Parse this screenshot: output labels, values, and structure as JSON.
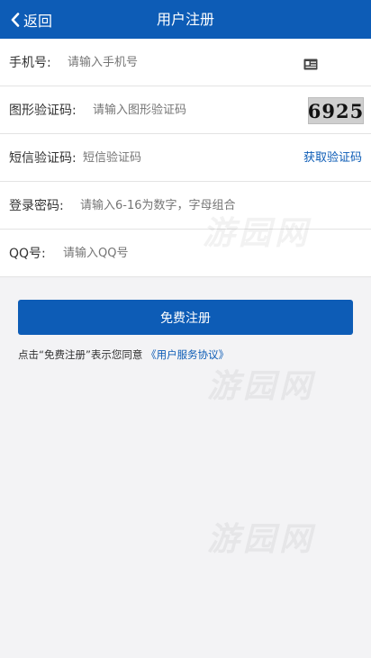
{
  "header": {
    "back_label": "返回",
    "title": "用户注册"
  },
  "form": {
    "phone": {
      "label": "手机号:",
      "placeholder": "请输入手机号",
      "icon": "id-card-icon"
    },
    "image_code": {
      "label": "图形验证码:",
      "placeholder": "请输入图形验证码",
      "captcha_text": "6925"
    },
    "sms_code": {
      "label": "短信验证码:",
      "placeholder": "短信验证码",
      "send_label": "获取验证码"
    },
    "password": {
      "label": "登录密码:",
      "placeholder": "请输入6-16为数字，字母组合"
    },
    "qq": {
      "label": "QQ号:",
      "placeholder": "请输入QQ号"
    }
  },
  "submit_label": "免费注册",
  "agreement": {
    "prefix": "点击“免费注册”表示您同意",
    "link": "《用户服务协议》"
  },
  "watermark": "游园网",
  "colors": {
    "primary": "#0d5cb6",
    "background": "#f3f3f5"
  }
}
